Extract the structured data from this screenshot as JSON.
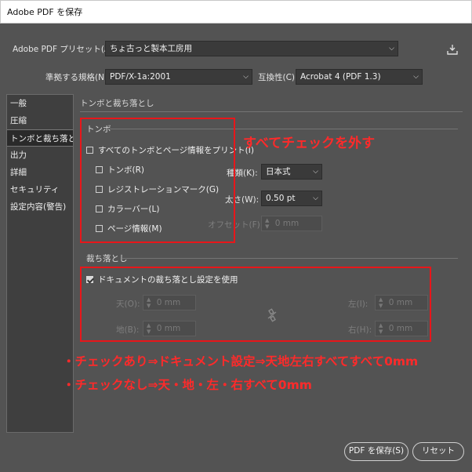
{
  "window": {
    "title": "Adobe PDF を保存"
  },
  "preset": {
    "label": "Adobe PDF プリセット(A):",
    "value": "ちょ古っと製本工房用"
  },
  "standard": {
    "label": "準拠する規格(N):",
    "value": "PDF/X-1a:2001"
  },
  "compat": {
    "label": "互換性(C):",
    "value": "Acrobat 4 (PDF 1.3)"
  },
  "sidebar": {
    "items": [
      {
        "label": "一般"
      },
      {
        "label": "圧縮"
      },
      {
        "label": "トンボと裁ち落とし"
      },
      {
        "label": "出力"
      },
      {
        "label": "詳細"
      },
      {
        "label": "セキュリティ"
      },
      {
        "label": "設定内容(警告)"
      }
    ]
  },
  "marks": {
    "section_title": "トンボと裁ち落とし",
    "group_label": "トンボ",
    "all_marks": {
      "label": "すべてのトンボとページ情報をプリント(I)",
      "checked": false
    },
    "trim": {
      "label": "トンボ(R)",
      "checked": false
    },
    "registration": {
      "label": "レジストレーションマーク(G)",
      "checked": false
    },
    "color_bar": {
      "label": "カラーバー(L)",
      "checked": false
    },
    "page_info": {
      "label": "ページ情報(M)",
      "checked": false
    },
    "kind": {
      "label": "種類(K):",
      "value": "日本式"
    },
    "weight": {
      "label": "太さ(W):",
      "value": "0.50 pt"
    },
    "offset": {
      "label": "オフセット(F):",
      "value": "0 mm"
    }
  },
  "bleed": {
    "section_title": "裁ち落とし",
    "use_doc": {
      "label": "ドキュメントの裁ち落とし設定を使用",
      "checked": true
    },
    "top": {
      "label": "天(O):",
      "value": "0 mm"
    },
    "bottom": {
      "label": "地(B):",
      "value": "0 mm"
    },
    "left": {
      "label": "左(I):",
      "value": "0 mm"
    },
    "right": {
      "label": "右(H):",
      "value": "0 mm"
    }
  },
  "annotations": {
    "uncheck_all": "すべてチェックを外す",
    "line1": "・チェックあり⇒ドキュメント設定⇒天地左右すべてすべて0mm",
    "line2": "・チェックなし⇒天・地・左・右すべて0mm"
  },
  "buttons": {
    "save": "PDF を保存(S)",
    "reset": "リセット"
  },
  "colors": {
    "annotation_red": "#e8161a",
    "panel_bg": "#535353"
  }
}
